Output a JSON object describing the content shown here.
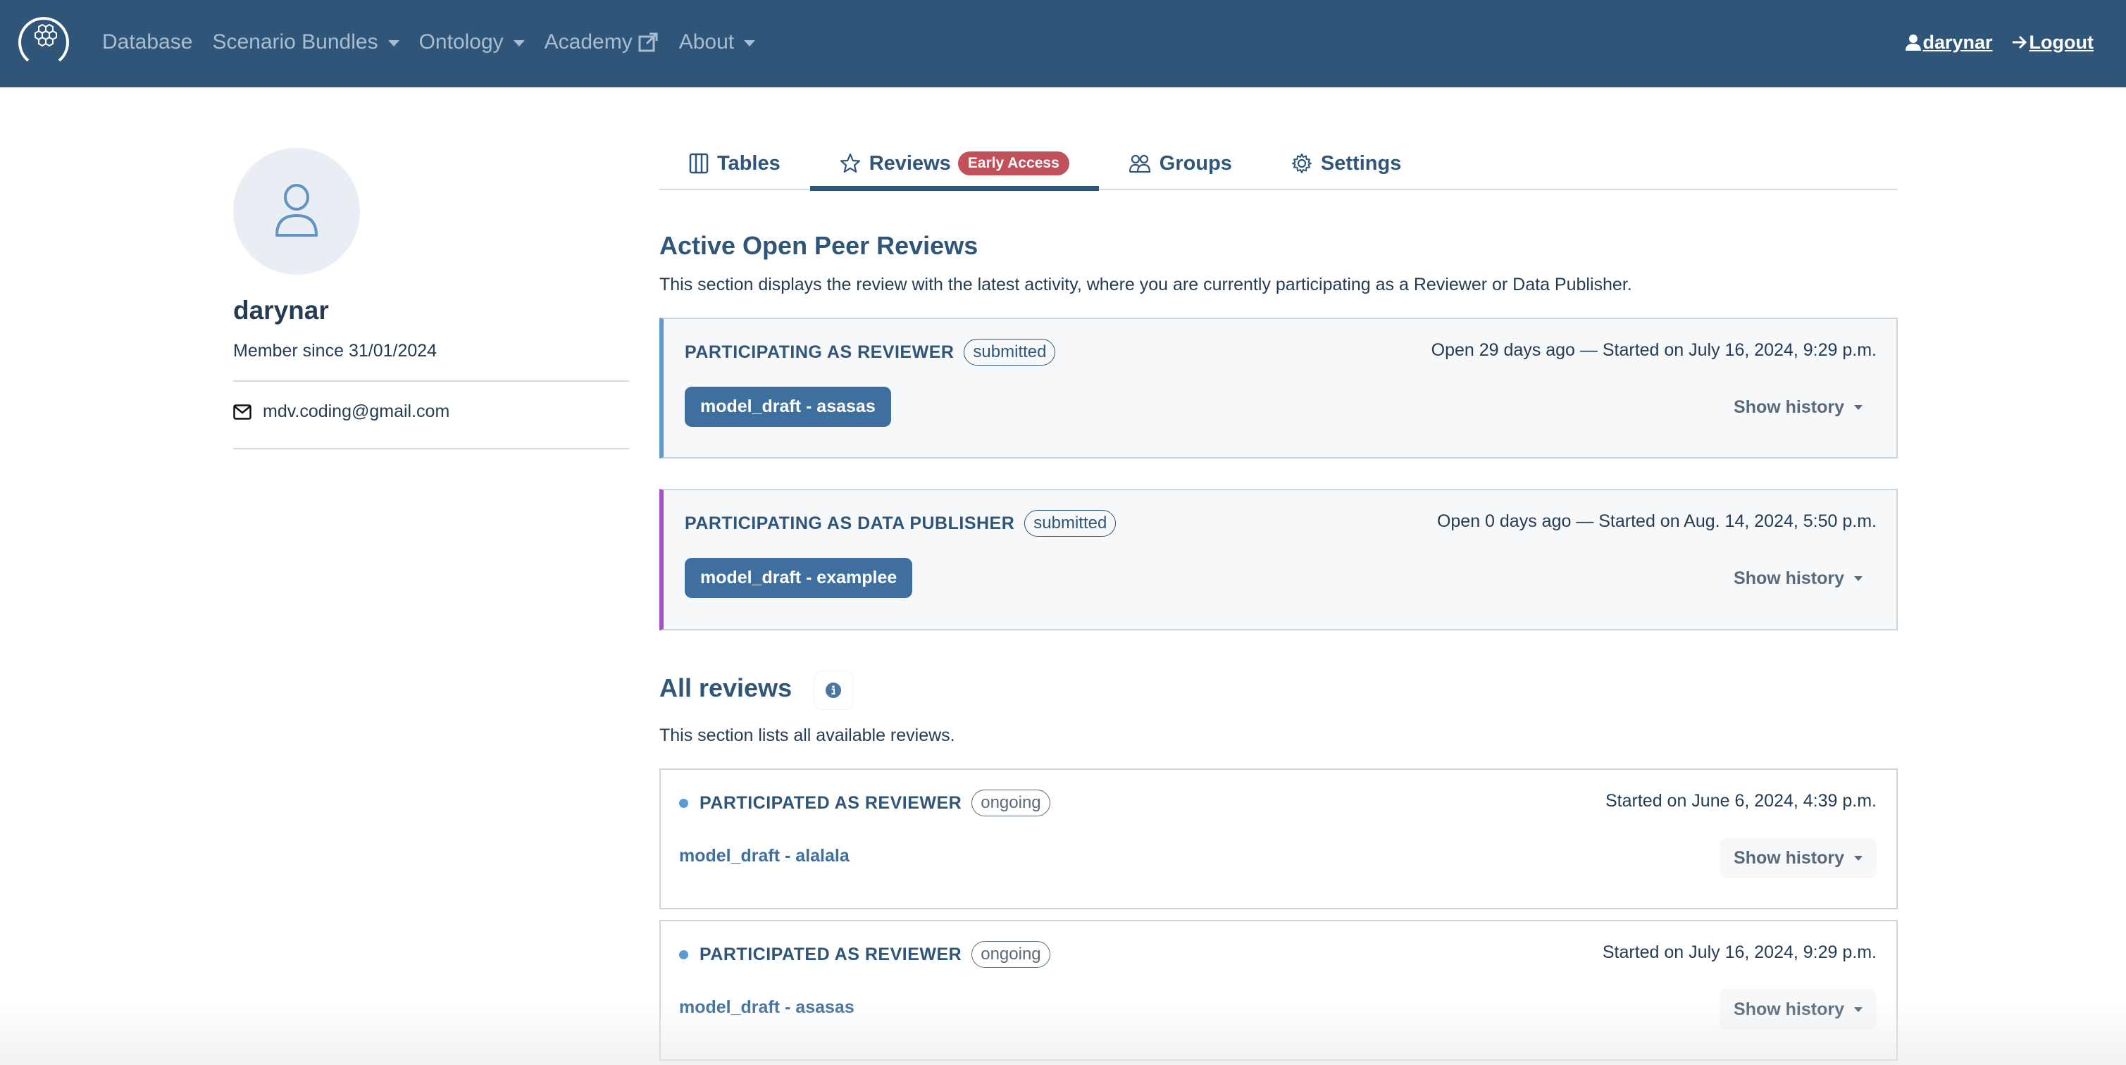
{
  "navbar": {
    "logo_icon": "hexagon-cluster-logo",
    "items": [
      {
        "label": "Database",
        "has_dropdown": false
      },
      {
        "label": "Scenario Bundles",
        "has_dropdown": true
      },
      {
        "label": "Ontology",
        "has_dropdown": true
      },
      {
        "label": "Academy",
        "has_dropdown": false,
        "external": true
      },
      {
        "label": "About",
        "has_dropdown": true
      }
    ],
    "user_label": " darynar",
    "logout_label": " Logout"
  },
  "profile": {
    "username": "darynar",
    "member_since": "Member since 31/01/2024",
    "email": "mdv.coding@gmail.com"
  },
  "tabs": [
    {
      "label": "Tables",
      "icon": "table-columns-icon",
      "active": false
    },
    {
      "label": "Reviews",
      "icon": "star-icon",
      "active": true,
      "badge": "Early Access"
    },
    {
      "label": "Groups",
      "icon": "people-icon",
      "active": false
    },
    {
      "label": "Settings",
      "icon": "gear-icon",
      "active": false
    }
  ],
  "active_section": {
    "title": "Active Open Peer Reviews",
    "description": "This section displays the review with the latest activity, where you are currently participating as a Reviewer or Data Publisher.",
    "cards": [
      {
        "role": "PARTICIPATING AS REVIEWER",
        "status": "submitted",
        "date": "Open 29 days ago — Started on July 16, 2024, 9:29 p.m.",
        "model": "model_draft - asasas",
        "history_label": "Show history",
        "accent_color": "#5b9bd1"
      },
      {
        "role": "PARTICIPATING AS DATA PUBLISHER",
        "status": "submitted",
        "date": "Open 0 days ago — Started on Aug. 14, 2024, 5:50 p.m.",
        "model": "model_draft - examplee",
        "history_label": "Show history",
        "accent_color": "#a64fce"
      }
    ]
  },
  "all_section": {
    "title": "All reviews",
    "description": "This section lists all available reviews.",
    "cards": [
      {
        "role": "PARTICIPATED AS REVIEWER",
        "status": "ongoing",
        "date": "Started on June 6, 2024, 4:39 p.m.",
        "model": "model_draft - alalala",
        "history_label": "Show history"
      },
      {
        "role": "PARTICIPATED AS REVIEWER",
        "status": "ongoing",
        "date": "Started on July 16, 2024, 9:29 p.m.",
        "model": "model_draft - asasas",
        "history_label": "Show history"
      }
    ]
  },
  "colors": {
    "navbar_bg": "#2f5679",
    "primary": "#2f5679",
    "button_bg": "#3f6f9e",
    "badge_red": "#c0505a",
    "reviewer_accent": "#5b9bd1",
    "publisher_accent": "#a64fce"
  }
}
